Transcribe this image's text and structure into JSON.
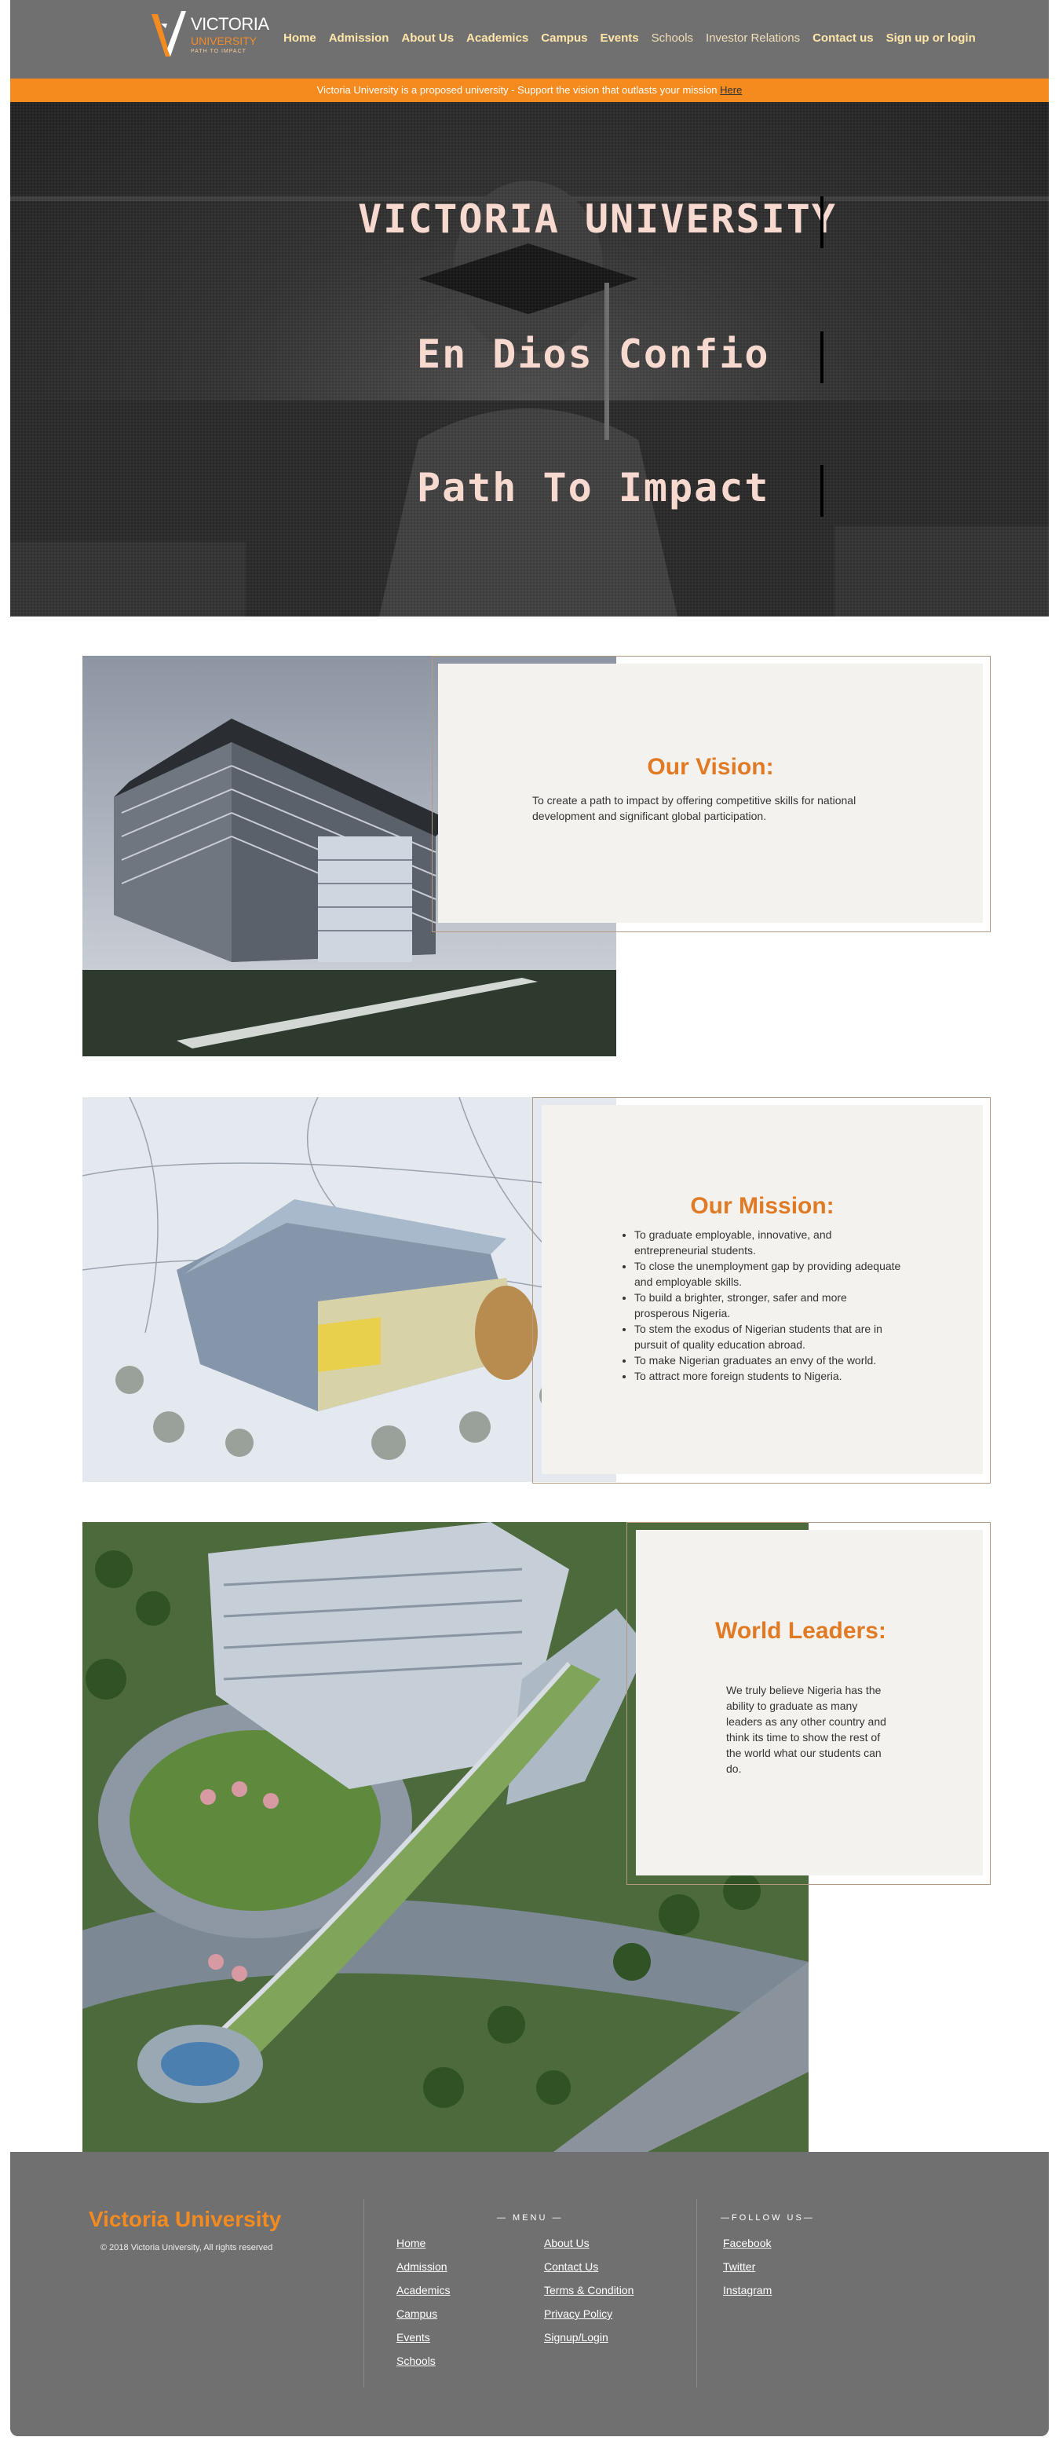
{
  "header": {
    "logo": {
      "word1": "VICTORIA",
      "word2": "UNIVERSITY",
      "word3": "PATH TO IMPACT"
    },
    "nav": [
      {
        "label": "Home"
      },
      {
        "label": "Admission"
      },
      {
        "label": "About Us"
      },
      {
        "label": "Academics"
      },
      {
        "label": "Campus"
      },
      {
        "label": "Events"
      },
      {
        "label": "Schools"
      },
      {
        "label": "Investor Relations"
      },
      {
        "label": "Contact us"
      },
      {
        "label": "Sign up or login"
      }
    ]
  },
  "banner": {
    "text": "Victoria University is a proposed university - Support the vision that outlasts your mission ",
    "link": "Here"
  },
  "hero": {
    "line1": "VICTORIA UNIVERSITY",
    "line2": "En Dios Confio",
    "line3": "Path To Impact"
  },
  "vision": {
    "title": "Our Vision:",
    "text": "To create a path to impact by offering competitive skills for national development and significant global participation."
  },
  "mission": {
    "title": "Our Mission:",
    "items": [
      "To graduate employable, innovative, and entrepreneurial students.",
      "To close the unemployment gap by providing adequate and employable skills.",
      "To build a brighter, stronger, safer and more prosperous Nigeria.",
      "To stem the exodus of Nigerian students that are in pursuit of quality education abroad.",
      "To make Nigerian graduates an envy of the world.",
      "To attract more foreign students to Nigeria."
    ]
  },
  "leaders": {
    "title": "World Leaders:",
    "text": "We truly believe Nigeria has the ability to graduate as many leaders as any other country and think its time to show the rest of the world what our students can do."
  },
  "footer": {
    "brand": "Victoria University",
    "copyright": "© 2018 Victoria University, All rights reserved",
    "menu_heading": "— MENU —",
    "menu_col1": [
      "Home",
      "Admission",
      "Academics",
      "Campus",
      "Events",
      "Schools"
    ],
    "menu_col2": [
      "About Us",
      "Contact Us",
      "Terms & Condition",
      "Privacy Policy",
      "Signup/Login"
    ],
    "follow_heading": "—FOLLOW US—",
    "social": [
      "Facebook",
      "Twitter",
      "Instagram"
    ]
  }
}
